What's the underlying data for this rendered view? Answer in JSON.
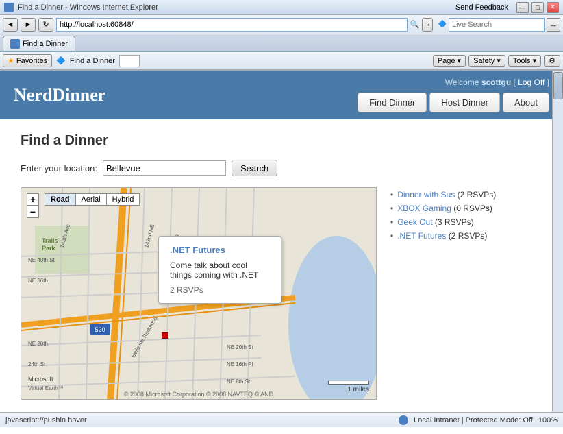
{
  "browser": {
    "title": "Find a Dinner - Windows Internet Explorer",
    "send_feedback": "Send Feedback",
    "address": "http://localhost:60848/",
    "search_placeholder": "Live Search",
    "tab_label": "Find a Dinner",
    "favorites_label": "Favorites",
    "minimize": "—",
    "maximize": "□",
    "close": "✕",
    "back": "◄",
    "forward": "►",
    "refresh": "↻",
    "toolbar_items": [
      "Page ▾",
      "Safety ▾",
      "Tools ▾"
    ],
    "status_left": "javascript://pushin hover",
    "status_right": "Local Intranet | Protected Mode: Off",
    "zoom": "100%"
  },
  "site": {
    "title": "NerdDinner",
    "welcome": "Welcome",
    "username": "scottgu",
    "log_off": "Log Off",
    "nav": {
      "find_dinner": "Find Dinner",
      "host_dinner": "Host Dinner",
      "about": "About"
    }
  },
  "page": {
    "heading": "Find a Dinner",
    "location_label": "Enter your location:",
    "location_value": "Bellevue",
    "search_button": "Search"
  },
  "map": {
    "type_buttons": [
      "Road",
      "Aerial",
      "Hybrid"
    ],
    "active_type": "Road",
    "zoom_in": "+",
    "zoom_out": "−",
    "scale_label": "1 miles",
    "copyright": "© 2008 Microsoft Corporation  © 2008 NAVTEQ  © AND",
    "brand": "Microsoft",
    "brand_sub": "Virtual Earth™",
    "popup": {
      "title": ".NET Futures",
      "description": "Come talk about cool things coming with .NET",
      "rsvps": "2 RSVPs"
    }
  },
  "results": [
    {
      "title": "Dinner with Sus",
      "rsvps": "2 RSVPs"
    },
    {
      "title": "XBOX Gaming",
      "rsvps": "0 RSVPs"
    },
    {
      "title": "Geek Out",
      "rsvps": "3 RSVPs"
    },
    {
      "title": ".NET Futures",
      "rsvps": "2 RSVPs"
    }
  ]
}
